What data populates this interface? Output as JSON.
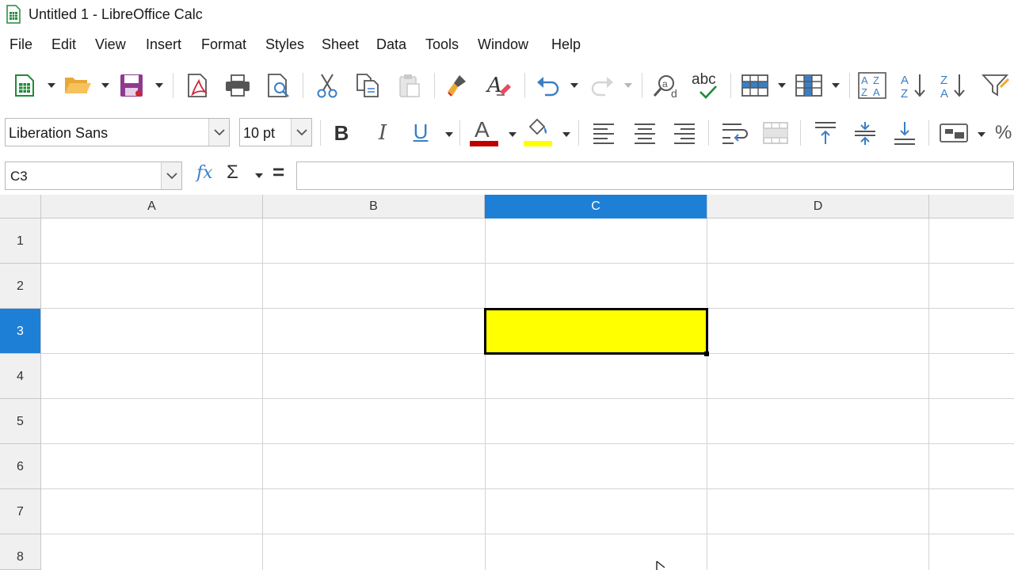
{
  "window": {
    "title": "Untitled 1 - LibreOffice Calc"
  },
  "menubar": {
    "items": [
      {
        "label": "File"
      },
      {
        "label": "Edit"
      },
      {
        "label": "View"
      },
      {
        "label": "Insert"
      },
      {
        "label": "Format"
      },
      {
        "label": "Styles"
      },
      {
        "label": "Sheet"
      },
      {
        "label": "Data"
      },
      {
        "label": "Tools"
      },
      {
        "label": "Window"
      },
      {
        "label": "Help"
      }
    ]
  },
  "toolbar_standard": {
    "icons": [
      "new-spreadsheet-icon",
      "open-folder-icon",
      "save-icon",
      "export-pdf-icon",
      "print-icon",
      "print-preview-icon",
      "cut-icon",
      "copy-icon",
      "paste-icon",
      "clone-formatting-icon",
      "clear-formatting-icon",
      "undo-icon",
      "redo-icon",
      "find-replace-icon",
      "spelling-icon",
      "row-icon",
      "column-icon",
      "sort-icon",
      "sort-ascending-icon",
      "sort-descending-icon",
      "autofilter-icon"
    ],
    "spelling_label": "abc"
  },
  "toolbar_formatting": {
    "font_name": "Liberation Sans",
    "font_size": "10 pt",
    "bold_label": "B",
    "italic_label": "I",
    "underline_label": "U",
    "font_color_label": "A",
    "font_color": "#c00000",
    "highlight_color": "#ffff00",
    "percent_label": "%"
  },
  "formula_bar": {
    "name_box": "C3",
    "fx_label": "fx",
    "sigma_label": "Σ",
    "equals_label": "=",
    "formula": ""
  },
  "sheet": {
    "columns": [
      "A",
      "B",
      "C",
      "D"
    ],
    "rows": [
      "1",
      "2",
      "3",
      "4",
      "5",
      "6",
      "7",
      "8"
    ],
    "active_column": "C",
    "active_row": "3",
    "selected_cell_fill": "#ffff00",
    "selection_color": "#1e7fd6"
  }
}
